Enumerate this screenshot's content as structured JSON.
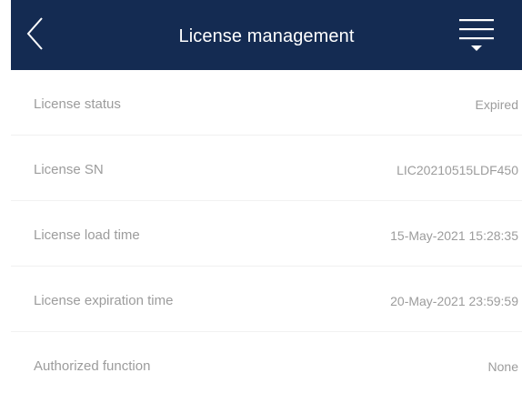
{
  "header": {
    "title": "License management",
    "back_icon": "chevron-left-icon",
    "menu_icon": "menu-dropdown-icon",
    "background_color": "#142b52"
  },
  "rows": [
    {
      "label": "License status",
      "value": "Expired"
    },
    {
      "label": "License SN",
      "value": "LIC20210515LDF450"
    },
    {
      "label": "License load time",
      "value": "15-May-2021 15:28:35"
    },
    {
      "label": "License expiration time",
      "value": "20-May-2021 23:59:59"
    },
    {
      "label": "Authorized function",
      "value": "None"
    }
  ]
}
